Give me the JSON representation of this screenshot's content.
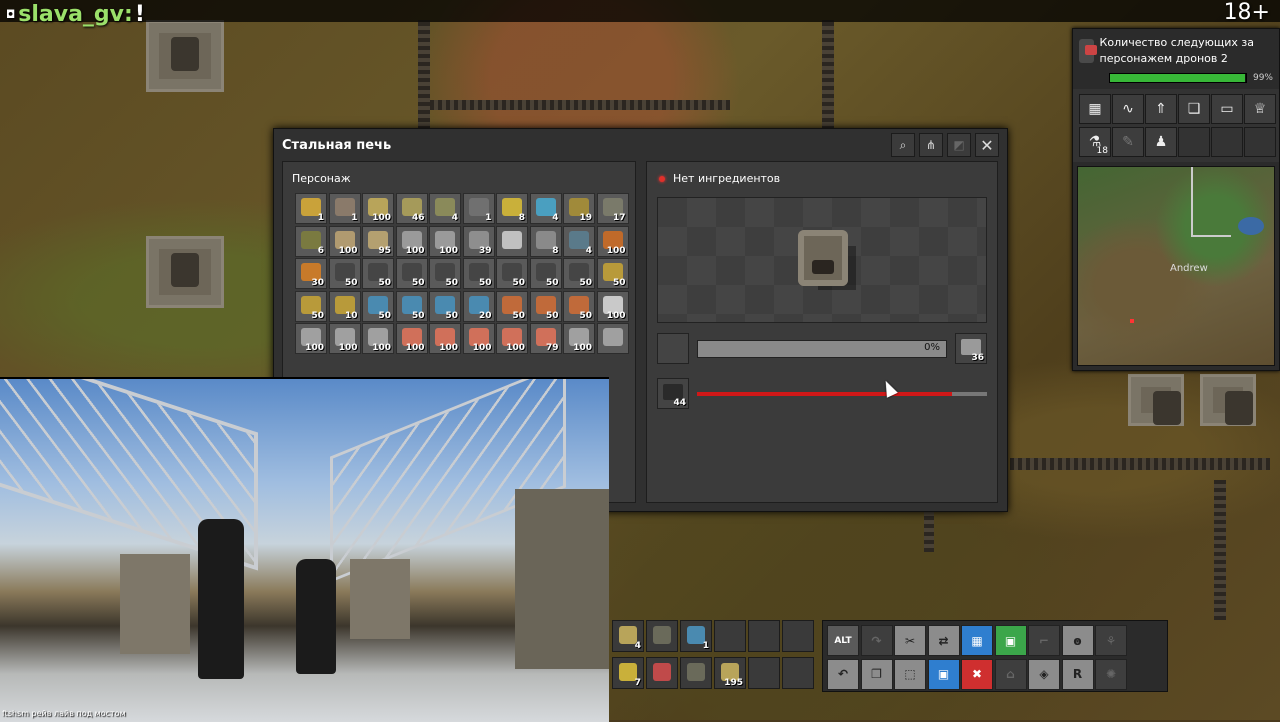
{
  "chat": {
    "username": "slava_gv",
    "colon": ":",
    "message": "!",
    "icon": "speech-icon"
  },
  "age_rating": "18+",
  "shortcut": {
    "text": "Количество следующих за персонажем дронов 2",
    "progress_percent": 99,
    "progress_label": "99%",
    "button_icons": [
      "map-grid-icon",
      "graph-icon",
      "upgrade-icon",
      "book-icon",
      "train-icon",
      "trophy-icon",
      "research-icon",
      "blueprint-icon",
      "character-icon",
      "empty",
      "empty",
      "empty"
    ],
    "research_count": "18"
  },
  "minimap": {
    "player_label": "Andrew"
  },
  "dialog": {
    "title": "Стальная печь",
    "header_buttons": [
      "search-icon",
      "network-icon",
      "pin-icon",
      "close-icon"
    ],
    "inventory_title": "Персонаж",
    "inventory_rows": [
      [
        {
          "c": "#c9a23a",
          "n": "1"
        },
        {
          "c": "#8a7a6a",
          "n": "1"
        },
        {
          "c": "#b8a45a",
          "n": "100"
        },
        {
          "c": "#a59a5a",
          "n": "46"
        },
        {
          "c": "#8a8a5a",
          "n": "4"
        },
        {
          "c": "#707070",
          "n": "1"
        },
        {
          "c": "#c9b03a",
          "n": "8"
        },
        {
          "c": "#4a9fc0",
          "n": "4"
        },
        {
          "c": "#a08a3a",
          "n": "19"
        },
        {
          "c": "#7a7a6a",
          "n": "17"
        }
      ],
      [
        {
          "c": "#7a7a40",
          "n": "6"
        },
        {
          "c": "#b09a70",
          "n": "100"
        },
        {
          "c": "#b4a070",
          "n": "95"
        },
        {
          "c": "#9a9a9a",
          "n": "100"
        },
        {
          "c": "#9a9a9a",
          "n": "100"
        },
        {
          "c": "#8e8e8e",
          "n": "39"
        },
        {
          "c": "#c0c0c0",
          "n": ""
        },
        {
          "c": "#8a8a8a",
          "n": "8"
        },
        {
          "c": "#5a7a8a",
          "n": "4"
        },
        {
          "c": "#c06a2a",
          "n": "100"
        }
      ],
      [
        {
          "c": "#c87a2a",
          "n": "30"
        },
        {
          "c": "#454545",
          "n": "50"
        },
        {
          "c": "#454545",
          "n": "50"
        },
        {
          "c": "#454545",
          "n": "50"
        },
        {
          "c": "#454545",
          "n": "50"
        },
        {
          "c": "#454545",
          "n": "50"
        },
        {
          "c": "#454545",
          "n": "50"
        },
        {
          "c": "#454545",
          "n": "50"
        },
        {
          "c": "#454545",
          "n": "50"
        },
        {
          "c": "#b89a3a",
          "n": "50"
        }
      ],
      [
        {
          "c": "#b89a3a",
          "n": "50"
        },
        {
          "c": "#b89a3a",
          "n": "10"
        },
        {
          "c": "#4a8ab0",
          "n": "50"
        },
        {
          "c": "#4a8ab0",
          "n": "50"
        },
        {
          "c": "#4a8ab0",
          "n": "50"
        },
        {
          "c": "#4a8ab0",
          "n": "20"
        },
        {
          "c": "#c06a3a",
          "n": "50"
        },
        {
          "c": "#c06a3a",
          "n": "50"
        },
        {
          "c": "#c06a3a",
          "n": "50"
        },
        {
          "c": "#c9c9c9",
          "n": "100"
        }
      ],
      [
        {
          "c": "#a0a0a0",
          "n": "100"
        },
        {
          "c": "#a0a0a0",
          "n": "100"
        },
        {
          "c": "#a0a0a0",
          "n": "100"
        },
        {
          "c": "#d0705a",
          "n": "100"
        },
        {
          "c": "#d0705a",
          "n": "100"
        },
        {
          "c": "#d0705a",
          "n": "100"
        },
        {
          "c": "#d0705a",
          "n": "100"
        },
        {
          "c": "#d0705a",
          "n": "79"
        },
        {
          "c": "#a0a0a0",
          "n": "100"
        },
        {
          "c": "#a0a0a0",
          "n": ""
        }
      ]
    ],
    "status_text": "Нет ингредиентов",
    "craft_progress_label": "0%",
    "result_count": "36",
    "fuel_count": "44",
    "fuel_level": 0.88
  },
  "webcam": {
    "caption": "ftshsm рейв лайв под мостом"
  },
  "quickbar": [
    {
      "c": "#b8a45a",
      "n": "4"
    },
    {
      "c": "#6a6a5a",
      "n": ""
    },
    {
      "c": "#4a8ab0",
      "n": "1"
    },
    {
      "c": "",
      "n": ""
    },
    {
      "c": "",
      "n": ""
    },
    {
      "c": "",
      "n": ""
    },
    {
      "c": "#c9b03a",
      "n": "7"
    },
    {
      "c": "#c04a4a",
      "n": ""
    },
    {
      "c": "#6a6a5a",
      "n": ""
    },
    {
      "c": "#b8a45a",
      "n": "195"
    },
    {
      "c": "",
      "n": ""
    },
    {
      "c": "",
      "n": ""
    }
  ],
  "tools": [
    {
      "t": "ALT",
      "k": "alt"
    },
    {
      "t": "↷",
      "k": "dark"
    },
    {
      "t": "✂",
      "k": ""
    },
    {
      "t": "⇄",
      "k": ""
    },
    {
      "t": "▦",
      "k": "blue"
    },
    {
      "t": "▣",
      "k": "green"
    },
    {
      "t": "⌐",
      "k": "dark"
    },
    {
      "t": "ꙩ",
      "k": ""
    },
    {
      "t": "⚘",
      "k": "dark"
    },
    {
      "t": "↶",
      "k": ""
    },
    {
      "t": "❐",
      "k": ""
    },
    {
      "t": "⬚",
      "k": ""
    },
    {
      "t": "▣",
      "k": "blue"
    },
    {
      "t": "✖",
      "k": "red"
    },
    {
      "t": "⌂",
      "k": "dark"
    },
    {
      "t": "◈",
      "k": ""
    },
    {
      "t": "R",
      "k": ""
    },
    {
      "t": "✺",
      "k": "dark"
    }
  ]
}
